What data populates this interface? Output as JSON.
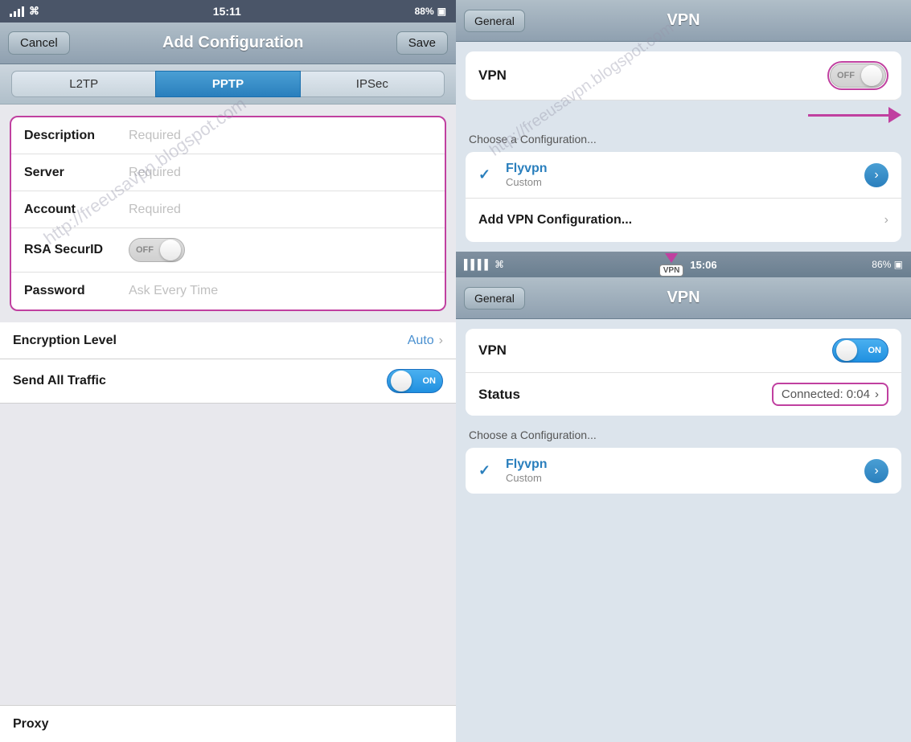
{
  "left": {
    "status_bar": {
      "time": "15:11",
      "battery": "88%",
      "wifi": "WiFi"
    },
    "nav": {
      "cancel_label": "Cancel",
      "title": "Add Configuration",
      "save_label": "Save"
    },
    "tabs": [
      {
        "label": "L2TP",
        "active": false
      },
      {
        "label": "PPTP",
        "active": true
      },
      {
        "label": "IPSec",
        "active": false
      }
    ],
    "form": {
      "rows": [
        {
          "label": "Description",
          "value": "Required",
          "type": "text"
        },
        {
          "label": "Server",
          "value": "Required",
          "type": "text"
        },
        {
          "label": "Account",
          "value": "Required",
          "type": "text"
        },
        {
          "label": "RSA SecurID",
          "value": "",
          "type": "toggle_off"
        },
        {
          "label": "Password",
          "value": "Ask Every Time",
          "type": "text"
        }
      ]
    },
    "encryption_row": {
      "label": "Encryption Level",
      "value": "Auto"
    },
    "send_traffic_row": {
      "label": "Send All Traffic",
      "toggle": "ON"
    },
    "proxy_row": {
      "label": "Proxy"
    },
    "watermark": "http://freeusavpn.blogspot.com"
  },
  "right": {
    "top_screen": {
      "header": {
        "back_label": "General",
        "title": "VPN"
      },
      "vpn_row": {
        "label": "VPN",
        "toggle": "OFF"
      },
      "section_label": "Choose a Configuration...",
      "config_list": {
        "items": [
          {
            "name": "Flyvpn",
            "type": "Custom",
            "checked": true
          }
        ],
        "add_label": "Add VPN Configuration..."
      }
    },
    "divider": {
      "time": "15:06",
      "battery": "86%",
      "vpn_badge": "VPN"
    },
    "bottom_screen": {
      "header": {
        "back_label": "General",
        "title": "VPN"
      },
      "vpn_row": {
        "label": "VPN",
        "toggle": "ON"
      },
      "status_row": {
        "label": "Status",
        "value": "Connected: 0:04"
      },
      "section_label": "Choose a Configuration...",
      "config_list": {
        "items": [
          {
            "name": "Flyvpn",
            "type": "Custom",
            "checked": true
          }
        ]
      }
    },
    "watermark": "http://freeusavpn.blogspot.com"
  }
}
